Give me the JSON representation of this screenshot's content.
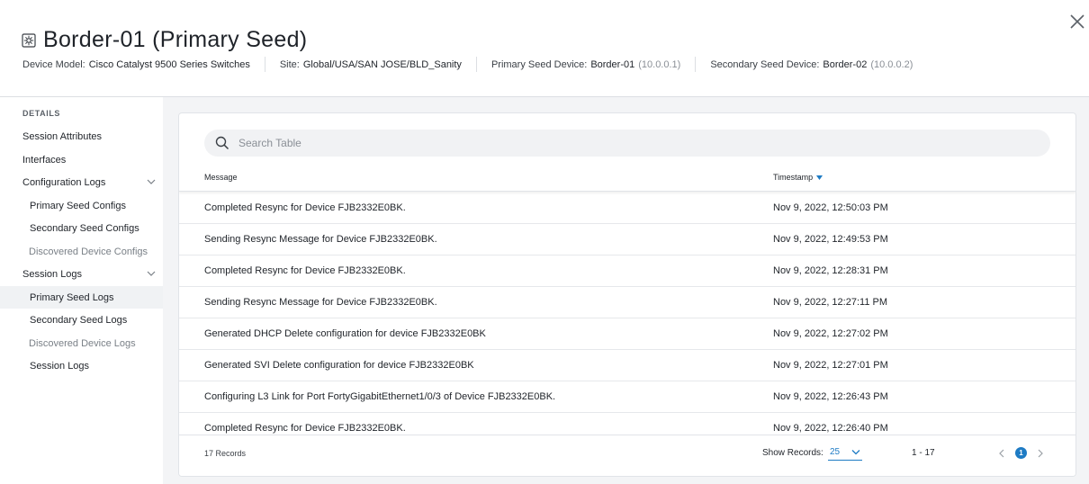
{
  "header": {
    "title": "Border-01 (Primary Seed)",
    "icon": "device-icon",
    "device_model_label": "Device Model:",
    "device_model_value": "Cisco Catalyst 9500 Series Switches",
    "site_label": "Site:",
    "site_value": "Global/USA/SAN JOSE/BLD_Sanity",
    "primary_label": "Primary Seed Device:",
    "primary_value": "Border-01",
    "primary_ip": "(10.0.0.1)",
    "secondary_label": "Secondary Seed Device:",
    "secondary_value": "Border-02",
    "secondary_ip": "(10.0.0.2)"
  },
  "sidebar": {
    "section_title": "DETAILS",
    "items": [
      {
        "label": "Session Attributes"
      },
      {
        "label": "Interfaces"
      },
      {
        "label": "Configuration Logs"
      },
      {
        "label": "Primary Seed Configs"
      },
      {
        "label": "Secondary Seed Configs"
      },
      {
        "label": "Discovered Device Configs"
      },
      {
        "label": "Session Logs"
      },
      {
        "label": "Primary Seed Logs"
      },
      {
        "label": "Secondary Seed Logs"
      },
      {
        "label": "Discovered Device Logs"
      },
      {
        "label": "Session Logs"
      }
    ],
    "active_item": "Primary Seed Logs"
  },
  "table": {
    "search_placeholder": "Search Table",
    "columns": {
      "message": "Message",
      "timestamp": "Timestamp"
    },
    "rows": [
      {
        "message": "Completed Resync for Device FJB2332E0BK.",
        "timestamp": "Nov 9, 2022, 12:50:03 PM"
      },
      {
        "message": "Sending Resync Message for Device FJB2332E0BK.",
        "timestamp": "Nov 9, 2022, 12:49:53 PM"
      },
      {
        "message": "Completed Resync for Device FJB2332E0BK.",
        "timestamp": "Nov 9, 2022, 12:28:31 PM"
      },
      {
        "message": "Sending Resync Message for Device FJB2332E0BK.",
        "timestamp": "Nov 9, 2022, 12:27:11 PM"
      },
      {
        "message": "Generated DHCP Delete configuration for device FJB2332E0BK",
        "timestamp": "Nov 9, 2022, 12:27:02 PM"
      },
      {
        "message": "Generated SVI Delete configuration for device FJB2332E0BK",
        "timestamp": "Nov 9, 2022, 12:27:01 PM"
      },
      {
        "message": "Configuring L3 Link for Port FortyGigabitEthernet1/0/3 of Device FJB2332E0BK.",
        "timestamp": "Nov 9, 2022, 12:26:43 PM"
      },
      {
        "message": "Completed Resync for Device FJB2332E0BK.",
        "timestamp": "Nov 9, 2022, 12:26:40 PM"
      }
    ]
  },
  "footer": {
    "records": "17 Records",
    "show_records_label": "Show Records:",
    "show_records_value": "25",
    "range": "1 - 17",
    "current_page": "1"
  },
  "colors": {
    "accent": "#1e7bc4",
    "active_bg": "#f0f2f4",
    "panel_bg": "#f3f4f6"
  }
}
